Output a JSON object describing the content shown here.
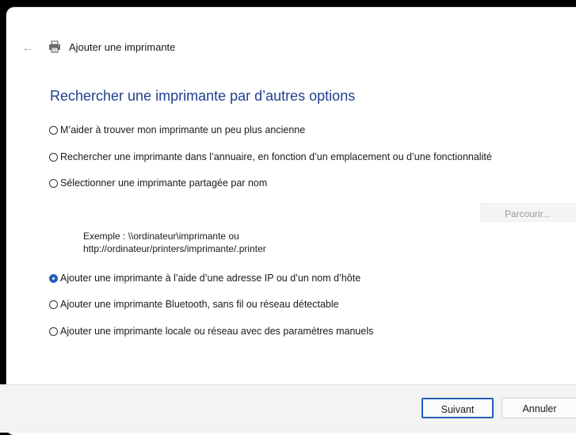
{
  "window": {
    "title": "Ajouter une imprimante",
    "back_icon": "arrow-left-icon",
    "printer_icon": "printer-icon"
  },
  "main": {
    "heading": "Rechercher une imprimante par d’autres options",
    "options": [
      {
        "label": "M’aider à trouver mon imprimante un peu plus ancienne",
        "checked": false
      },
      {
        "label": "Rechercher une imprimante dans l’annuaire, en fonction d’un emplacement ou d’une fonctionnalité",
        "checked": false
      },
      {
        "label": "Sélectionner une imprimante partagée par nom",
        "checked": false
      },
      {
        "label": "Ajouter une imprimante à l’aide d’une adresse IP ou d’un nom d’hôte",
        "checked": true
      },
      {
        "label": "Ajouter une imprimante Bluetooth, sans fil ou réseau détectable",
        "checked": false
      },
      {
        "label": "Ajouter une imprimante locale ou réseau avec des paramètres manuels",
        "checked": false
      }
    ],
    "browse_label": "Parcourir...",
    "example_line1": "Exemple : \\\\ordinateur\\imprimante ou",
    "example_line2": "http://ordinateur/printers/imprimante/.printer"
  },
  "footer": {
    "next_label": "Suivant",
    "cancel_label": "Annuler"
  },
  "colors": {
    "accent": "#1f5fb8",
    "heading": "#1f3f8f"
  }
}
